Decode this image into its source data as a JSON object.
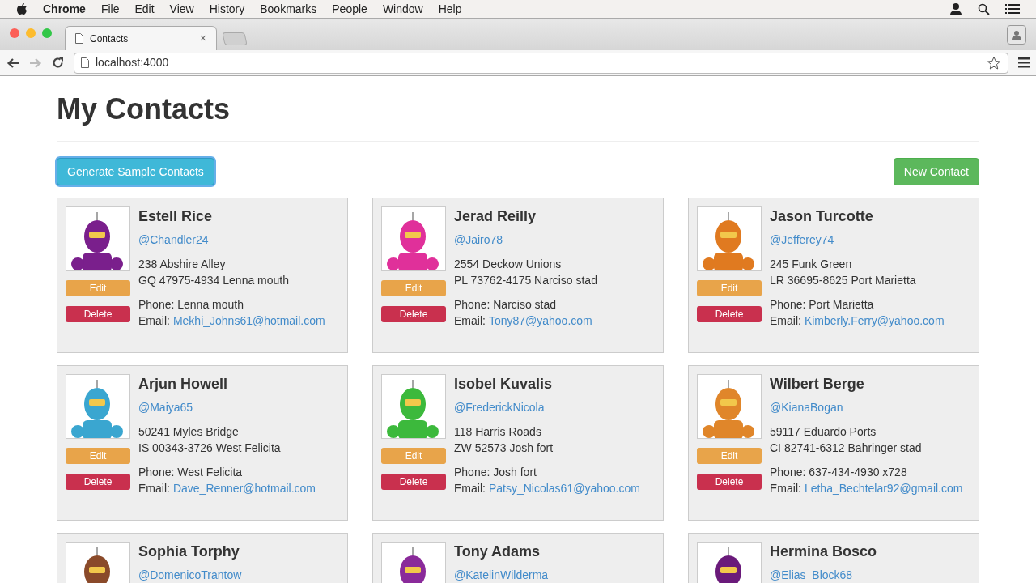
{
  "menubar": {
    "app": "Chrome",
    "menus": [
      "File",
      "Edit",
      "View",
      "History",
      "Bookmarks",
      "People",
      "Window",
      "Help"
    ]
  },
  "browser": {
    "tab": {
      "title": "Contacts",
      "close": "×"
    },
    "back_disabled": false,
    "forward_disabled": true,
    "url": "localhost:4000"
  },
  "page": {
    "title": "My Contacts",
    "generate_button": {
      "label": "Generate Sample Contacts",
      "focused": true
    },
    "new_button": "New Contact"
  },
  "contacts": [
    {
      "name": "Estell Rice",
      "handle": "@Chandler24",
      "address1": "238 Abshire Alley",
      "address2": "GQ 47975-4934 Lenna mouth",
      "phone": "Phone: Lenna mouth",
      "email_label": "Email:",
      "email": "Mekhi_Johns61@hotmail.com",
      "edit": "Edit",
      "delete": "Delete",
      "color": "#7a1f8c"
    },
    {
      "name": "Jerad Reilly",
      "handle": "@Jairo78",
      "address1": "2554 Deckow Unions",
      "address2": "PL 73762-4175 Narciso stad",
      "phone": "Phone: Narciso stad",
      "email_label": "Email:",
      "email": "Tony87@yahoo.com",
      "edit": "Edit",
      "delete": "Delete",
      "color": "#e0309a"
    },
    {
      "name": "Jason Turcotte",
      "handle": "@Jefferey74",
      "address1": "245 Funk Green",
      "address2": "LR 36695-8625 Port Marietta",
      "phone": "Phone: Port Marietta",
      "email_label": "Email:",
      "email": "Kimberly.Ferry@yahoo.com",
      "edit": "Edit",
      "delete": "Delete",
      "color": "#e07a20"
    },
    {
      "name": "Arjun Howell",
      "handle": "@Maiya65",
      "address1": "50241 Myles Bridge",
      "address2": "IS 00343-3726 West Felicita",
      "phone": "Phone: West Felicita",
      "email_label": "Email:",
      "email": "Dave_Renner@hotmail.com",
      "edit": "Edit",
      "delete": "Delete",
      "color": "#3aa6d0"
    },
    {
      "name": "Isobel Kuvalis",
      "handle": "@FrederickNicola",
      "address1": "118 Harris Roads",
      "address2": "ZW 52573 Josh fort",
      "phone": "Phone: Josh fort",
      "email_label": "Email:",
      "email": "Patsy_Nicolas61@yahoo.com",
      "edit": "Edit",
      "delete": "Delete",
      "color": "#3cb93c"
    },
    {
      "name": "Wilbert Berge",
      "handle": "@KianaBogan",
      "address1": "59117 Eduardo Ports",
      "address2": "CI 82741-6312 Bahringer stad",
      "phone": "Phone: 637-434-4930 x728",
      "email_label": "Email:",
      "email": "Letha_Bechtelar92@gmail.com",
      "edit": "Edit",
      "delete": "Delete",
      "color": "#e0862a"
    },
    {
      "name": "Sophia Torphy",
      "handle": "@DomenicoTrantow",
      "color": "#8a4a2a"
    },
    {
      "name": "Tony Adams",
      "handle": "@KatelinWilderma",
      "color": "#8a2a9a"
    },
    {
      "name": "Hermina Bosco",
      "handle": "@Elias_Block68",
      "color": "#6a1a7a"
    }
  ]
}
